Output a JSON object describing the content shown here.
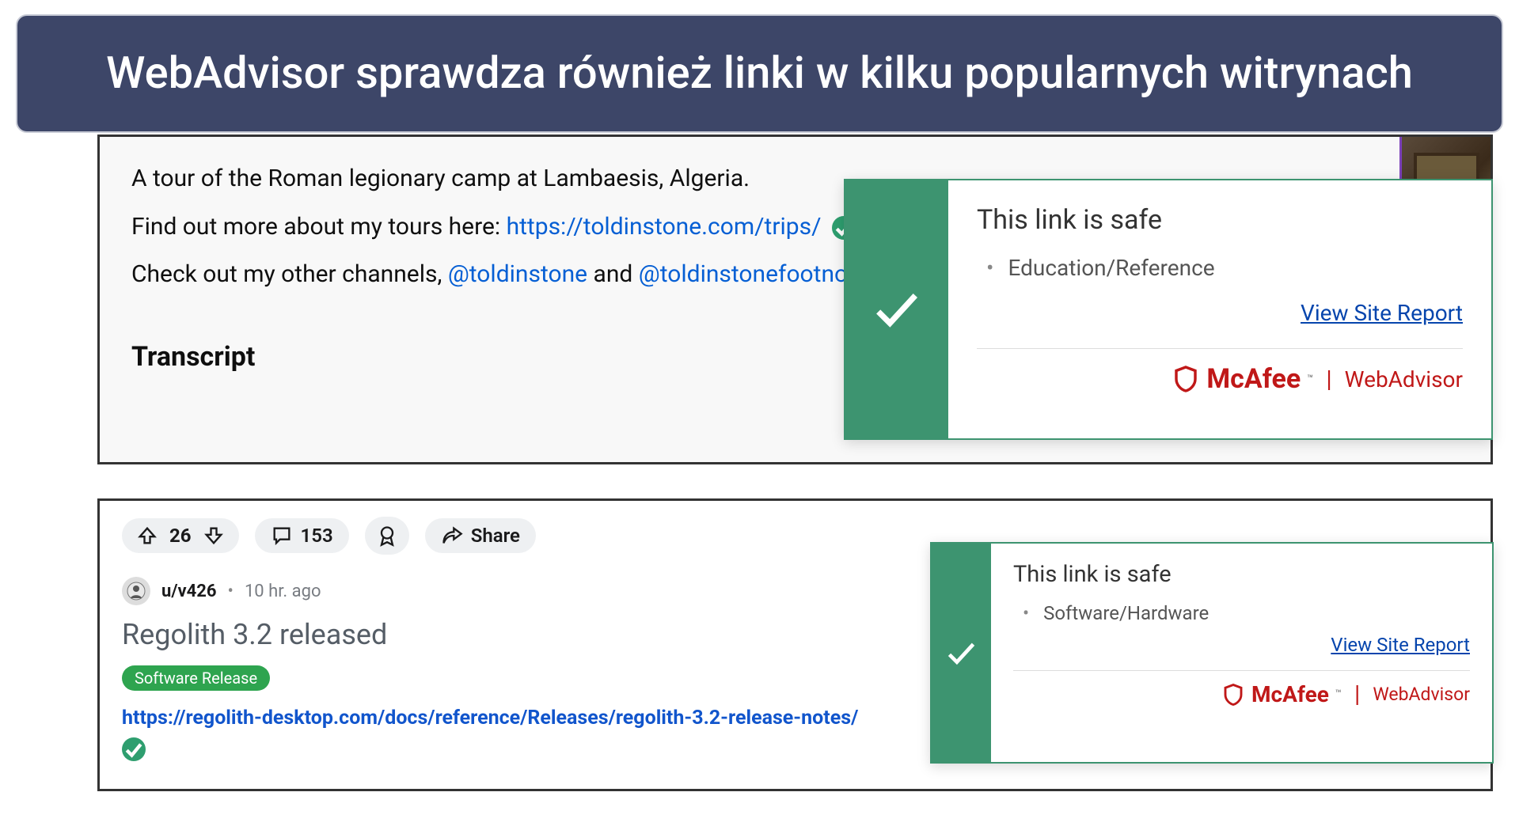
{
  "banner": {
    "text": "WebAdvisor sprawdza również linki w kilku popularnych witrynach"
  },
  "panel1": {
    "line1": "A tour of the Roman legionary camp at Lambaesis, Algeria.",
    "line2_prefix": "Find out more about my tours here: ",
    "line2_link": "https://toldinstone.com/trips/",
    "line3_prefix": "Check out my other channels, ",
    "line3_link1": "@toldinstone",
    "line3_mid": " and ",
    "line3_link2": "@toldinstonefootnot",
    "transcript_heading": "Transcript"
  },
  "popup1": {
    "title": "This link is safe",
    "category": "Education/Reference",
    "report_link": "View Site Report",
    "brand_mcafee": "McAfee",
    "brand_tm": "™",
    "brand_advisor": "WebAdvisor"
  },
  "reddit": {
    "vote_count": "26",
    "comment_count": "153",
    "share_label": "Share",
    "username": "u/v426",
    "time": "10 hr. ago",
    "title": "Regolith 3.2 released",
    "flair": "Software Release",
    "link": "https://regolith-desktop.com/docs/reference/Releases/regolith-3.2-release-notes/",
    "menu": "•••"
  },
  "popup2": {
    "title": "This link is safe",
    "category": "Software/Hardware",
    "report_link": "View Site Report",
    "brand_mcafee": "McAfee",
    "brand_tm": "™",
    "brand_advisor": "WebAdvisor"
  }
}
